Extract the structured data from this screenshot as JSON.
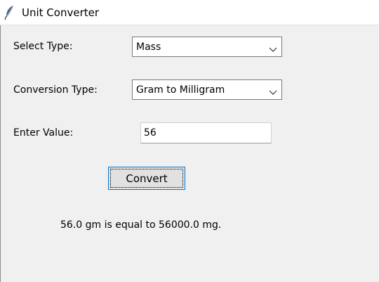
{
  "window": {
    "title": "Unit Converter",
    "icon": "feather-icon"
  },
  "form": {
    "select_type_label": "Select Type:",
    "select_type_value": "Mass",
    "conversion_type_label": "Conversion Type:",
    "conversion_type_value": "Gram to Milligram",
    "enter_value_label": "Enter Value:",
    "enter_value_value": "56",
    "convert_label": "Convert",
    "result_text": "56.0 gm is equal to 56000.0 mg."
  },
  "colors": {
    "focus_border": "#0078d7",
    "background": "#f0f0f0"
  }
}
